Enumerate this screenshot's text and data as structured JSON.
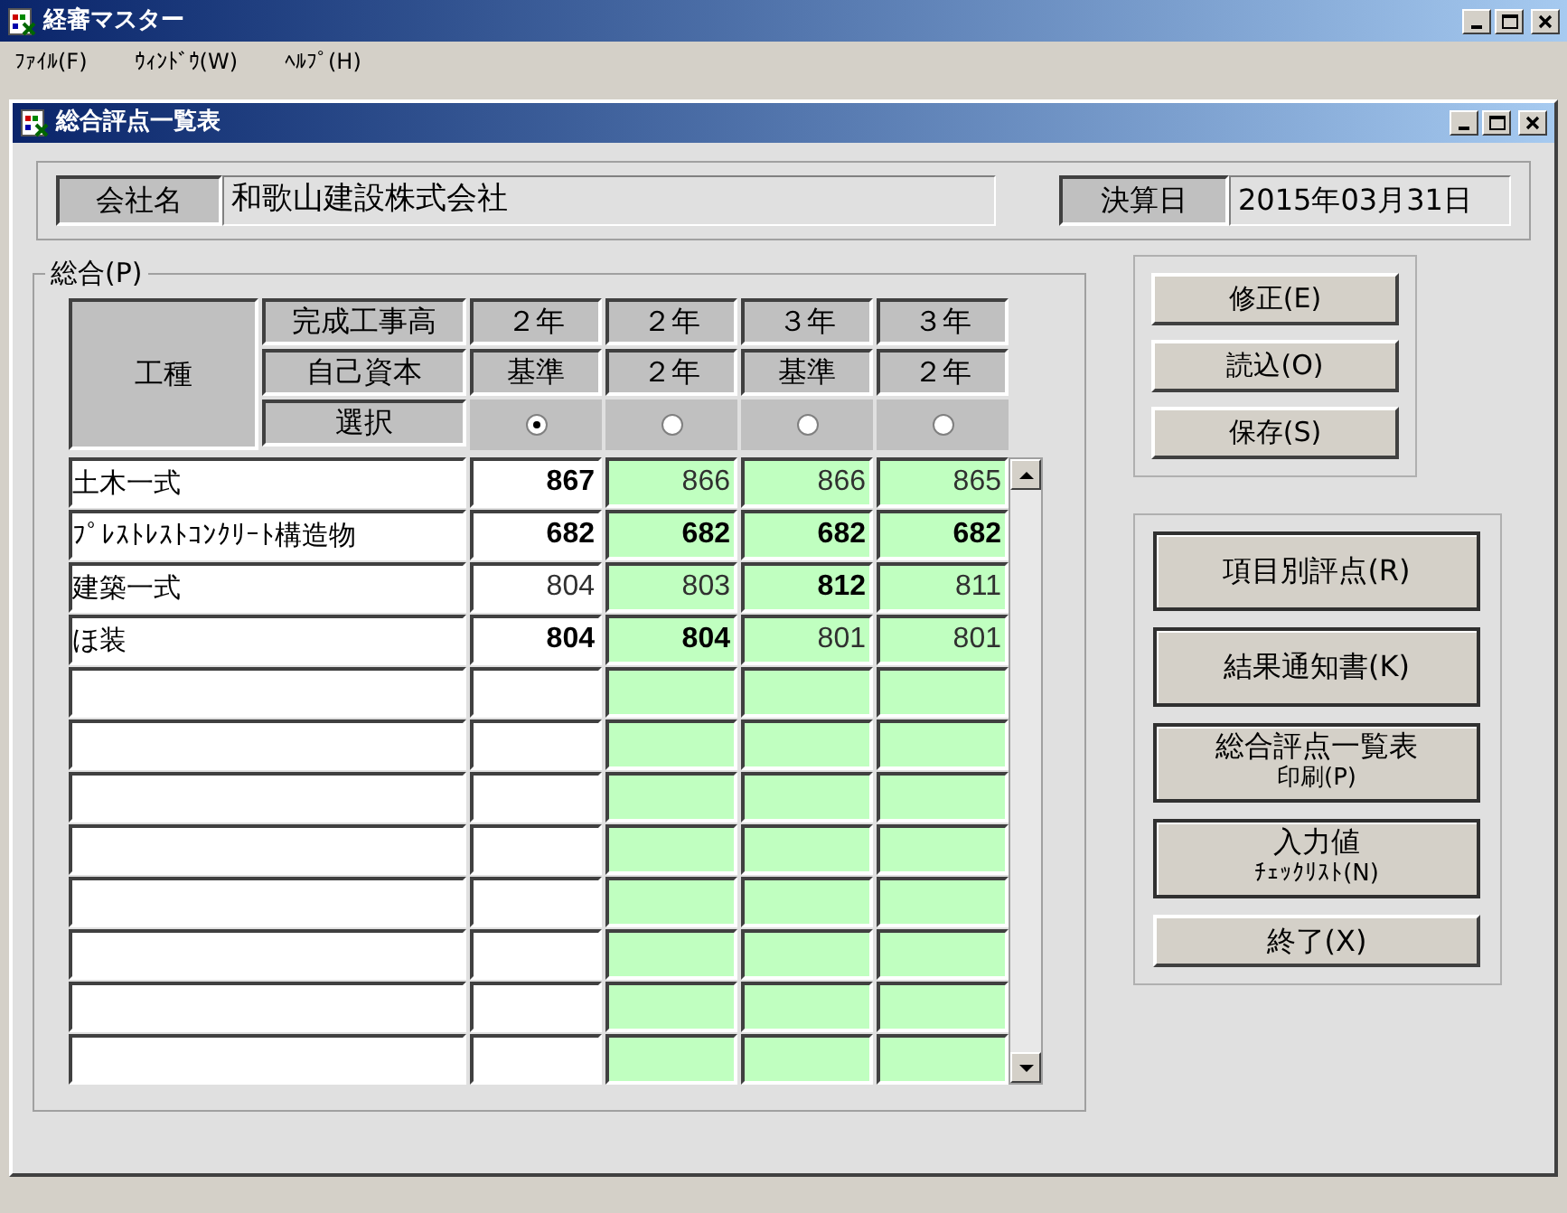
{
  "app": {
    "title": "経審マスター",
    "menu": [
      "ﾌｧｲﾙ(F)",
      "ｳｨﾝﾄﾞｳ(W)",
      "ﾍﾙﾌﾟ(H)"
    ]
  },
  "window": {
    "title": "総合評点一覧表"
  },
  "company": {
    "label": "会社名",
    "value": "和歌山建設株式会社"
  },
  "closing": {
    "label": "決算日",
    "value": "2015年03月31日"
  },
  "group": {
    "title": "総合(P)",
    "corner": "工種",
    "row_labels": [
      "完成工事高",
      "自己資本",
      "選択"
    ],
    "columns": [
      {
        "sales": "２年",
        "equity": "基準",
        "selected": true
      },
      {
        "sales": "２年",
        "equity": "２年",
        "selected": false
      },
      {
        "sales": "３年",
        "equity": "基準",
        "selected": false
      },
      {
        "sales": "３年",
        "equity": "２年",
        "selected": false
      }
    ],
    "rows": [
      {
        "kind": "data",
        "name": "土木一式",
        "cells": [
          {
            "value": "867",
            "bold": true
          },
          {
            "value": "866",
            "bold": false
          },
          {
            "value": "866",
            "bold": false
          },
          {
            "value": "865",
            "bold": false
          }
        ]
      },
      {
        "kind": "data",
        "name": "ﾌﾟﾚｽﾄﾚｽﾄｺﾝｸﾘｰﾄ構造物",
        "cells": [
          {
            "value": "682",
            "bold": true
          },
          {
            "value": "682",
            "bold": true
          },
          {
            "value": "682",
            "bold": true
          },
          {
            "value": "682",
            "bold": true
          }
        ]
      },
      {
        "kind": "data",
        "name": "建築一式",
        "cells": [
          {
            "value": "804",
            "bold": false
          },
          {
            "value": "803",
            "bold": false
          },
          {
            "value": "812",
            "bold": true
          },
          {
            "value": "811",
            "bold": false
          }
        ]
      },
      {
        "kind": "data",
        "name": "ほ装",
        "cells": [
          {
            "value": "804",
            "bold": true
          },
          {
            "value": "804",
            "bold": true
          },
          {
            "value": "801",
            "bold": false
          },
          {
            "value": "801",
            "bold": false
          }
        ]
      },
      {
        "kind": "blank"
      },
      {
        "kind": "blank"
      },
      {
        "kind": "blank"
      },
      {
        "kind": "blank"
      },
      {
        "kind": "blank"
      },
      {
        "kind": "blank"
      },
      {
        "kind": "blank"
      },
      {
        "kind": "blank"
      }
    ]
  },
  "edit_buttons": [
    "修正(E)",
    "読込(O)",
    "保存(S)"
  ],
  "report_buttons": [
    {
      "kind": "raised",
      "lines": [
        "項目別評点(R)"
      ]
    },
    {
      "kind": "raised",
      "lines": [
        "結果通知書(K)"
      ]
    },
    {
      "kind": "raised",
      "lines": [
        "総合評点一覧表",
        "印刷(P)"
      ]
    },
    {
      "kind": "raised",
      "lines": [
        "入力値",
        "ﾁｪｯｸﾘｽﾄ(N)"
      ]
    },
    {
      "kind": "flat",
      "lines": [
        "終了(X)"
      ]
    }
  ]
}
